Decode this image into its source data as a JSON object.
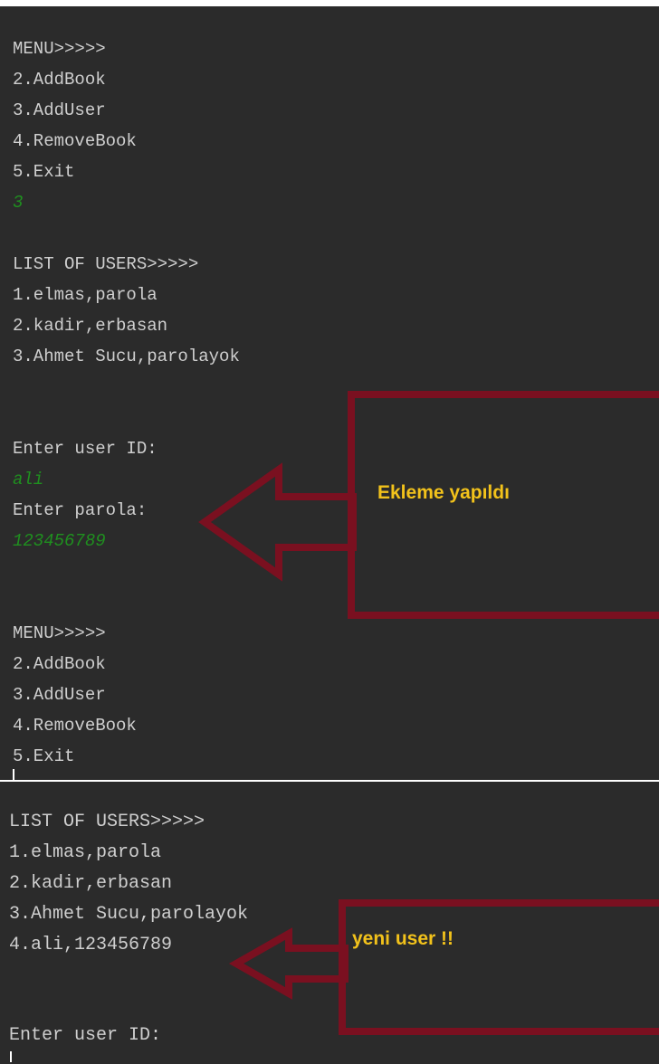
{
  "top_console": {
    "menu_header": "MENU>>>>>",
    "menu_items": [
      "2.AddBook",
      "3.AddUser",
      "4.RemoveBook",
      "5.Exit"
    ],
    "menu_input": "3",
    "users_header": "LIST OF USERS>>>>>",
    "users": [
      "1.elmas,parola",
      "2.kadir,erbasan",
      "3.Ahmet Sucu,parolayok"
    ],
    "prompt_user_id": "Enter user ID:",
    "input_user_id": "ali",
    "prompt_parola": "Enter parola:",
    "input_parola": "123456789",
    "menu2_header": "MENU>>>>>",
    "menu2_items": [
      "2.AddBook",
      "3.AddUser",
      "4.RemoveBook",
      "5.Exit"
    ]
  },
  "bottom_console": {
    "users_header": "LIST OF USERS>>>>>",
    "users": [
      "1.elmas,parola",
      "2.kadir,erbasan",
      "3.Ahmet Sucu,parolayok",
      "4.ali,123456789"
    ],
    "prompt_user_id": "Enter user ID:"
  },
  "annotations": {
    "callout_top": "Ekleme yapıldı",
    "callout_bottom": "yeni user !!"
  },
  "colors": {
    "console_bg": "#2b2b2b",
    "console_text": "#cfcfcf",
    "input_text": "#1f8f1f",
    "callout_border": "#7a1020",
    "callout_text": "#f2c21b"
  }
}
